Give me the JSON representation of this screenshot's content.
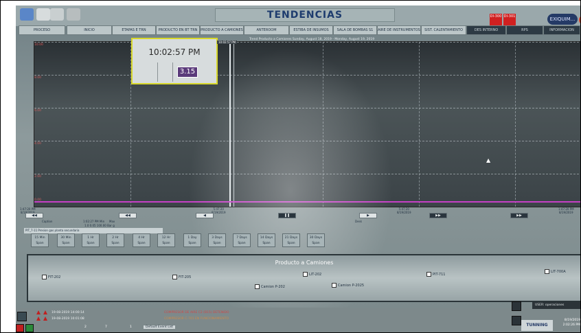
{
  "header": {
    "title": "TENDENCIAS",
    "logo_text": "EXIQUIM...",
    "print_label": "PRINT",
    "red_box_1": "DI-300",
    "red_box_2": "DI-301"
  },
  "nav": {
    "items": [
      "PROCESO",
      "INICIO",
      "ETAPAS E TRN",
      "PRODUCTO EN BT TRN",
      "PRODUCTO A CAMIONES",
      "ANTEROOM",
      "ESTIBA DE INSUMOS",
      "SALA DE BOMBAS S1",
      "AIRE DE INSTRUMENTOS",
      "SIST. CALENTAMIENTO",
      "DES INTERNO",
      "RPS",
      "INFORMACION"
    ]
  },
  "trend": {
    "subtitle": "Trend Producto a Camiones    Sunday, August 18, 2019 - Monday, August 19, 2019",
    "popup_time": "10:02:57 PM",
    "popup_value": "3.15",
    "cursor_time": "10:02:57 PM",
    "y_ticks": [
      "10.00",
      "8.00",
      "6.00",
      "4.00",
      "2.00",
      "0.00"
    ],
    "x_ticks": [
      {
        "time": "1:47:20 PM",
        "date": "8/18/2019"
      },
      {
        "time": "5:47:20",
        "date": "8/19/2019"
      },
      {
        "time": "5:47:20",
        "date": "8/19/2019"
      },
      {
        "time": "1:47:20 PM",
        "date": "8/19/2019"
      }
    ],
    "info_caption": "Caption",
    "info_time": "1:02:27 PM",
    "info_min": "Min",
    "info_max": "Max",
    "info_scale": "1.0 0.05 100.00 Bar g",
    "legend_text": "PIT_7-11 Presion gas planta secundaria",
    "end_label": "Desk"
  },
  "spans": [
    {
      "l1": "15 Min",
      "l2": "Span"
    },
    {
      "l1": "30 Min",
      "l2": "Span"
    },
    {
      "l1": "1 Hr",
      "l2": "Span"
    },
    {
      "l1": "2 Hr",
      "l2": "Span"
    },
    {
      "l1": "4 Hr",
      "l2": "Span"
    },
    {
      "l1": "12 Hr",
      "l2": "Span"
    },
    {
      "l1": "1 Day",
      "l2": "Span"
    },
    {
      "l1": "3 Days",
      "l2": "Span"
    },
    {
      "l1": "7 Days",
      "l2": "Span"
    },
    {
      "l1": "14 Days",
      "l2": "Span"
    },
    {
      "l1": "21 Days",
      "l2": "Span"
    },
    {
      "l1": "30 Days",
      "l2": "Span"
    }
  ],
  "producto": {
    "title": "Producto a Camiones",
    "checks": [
      "FIT-202",
      "FIT-205",
      "LIT-202",
      "PIT-711",
      "LIT-700A",
      "Camion P-202",
      "Camion P-2025"
    ]
  },
  "alarms": {
    "rows": [
      {
        "ts": "19-08-2019 14:00:14",
        "msg": "COMPRESOR DE AIRE C2 (B15) DETENIDO",
        "color": "#d04848"
      },
      {
        "ts": "19-08-2019 10:01:08",
        "msg": "COMPRESOR C-701 EN FUNCIONAMIENTO",
        "color": "#d08a48"
      }
    ],
    "count_a": "2",
    "count_b": "7",
    "count_c": "1",
    "event_list_label": "Default Event List"
  },
  "footer": {
    "user_label": "USER: operaciones",
    "tuning": "TUNNING",
    "date": "8/19/2019",
    "time": "2:02:26 PM"
  },
  "colors": {
    "title_blue": "#1e3c6e",
    "alarm_red": "#c02020",
    "trend_line": "#c640c6",
    "popup_border": "#d8d82a"
  }
}
